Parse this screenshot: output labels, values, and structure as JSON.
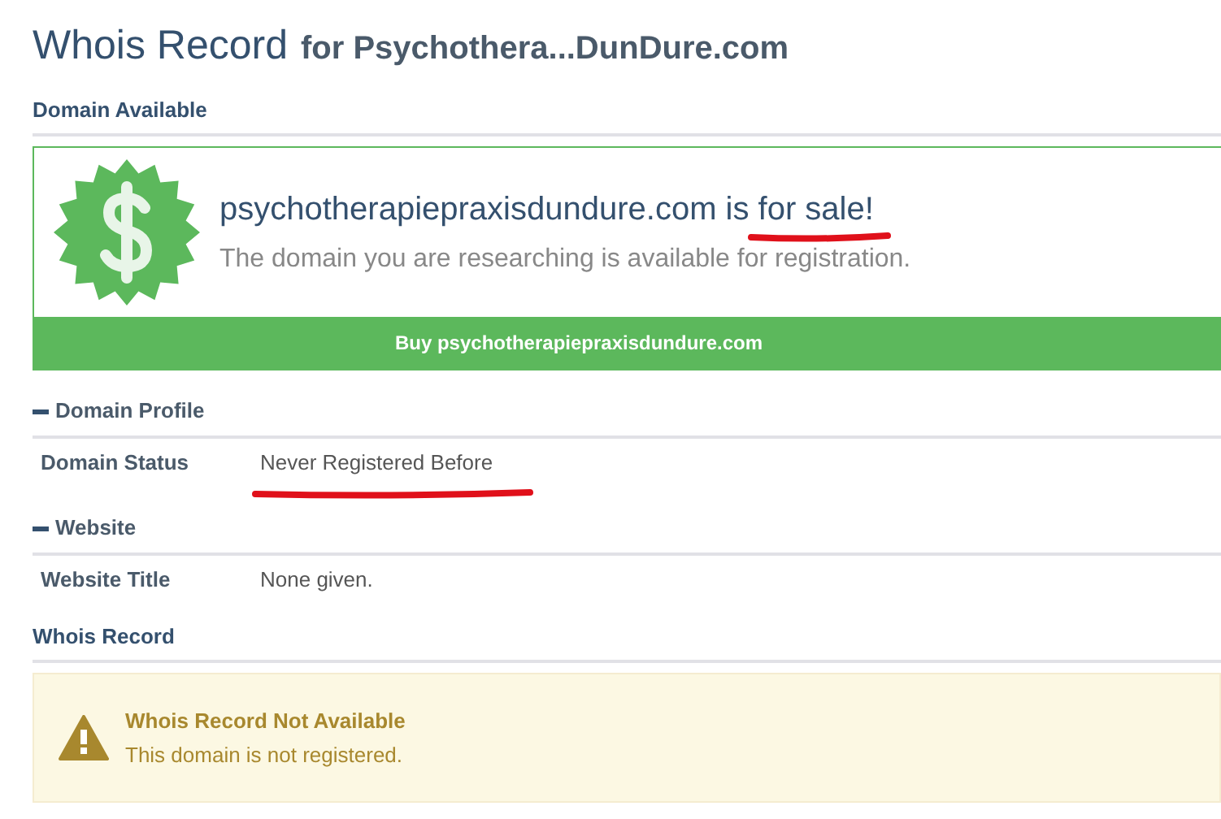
{
  "header": {
    "title": "Whois Record",
    "subtitle": "for Psychothera...DunDure.com"
  },
  "availability": {
    "heading": "Domain Available",
    "domain_line": "psychotherapiepraxisdundure.com is for sale!",
    "description": "The domain you are researching is available for registration.",
    "buy_button": "Buy psychotherapiepraxisdundure.com"
  },
  "sections": [
    {
      "title": "Domain Profile",
      "expanded": true,
      "rows": [
        {
          "label": "Domain Status",
          "value": "Never Registered Before"
        }
      ]
    },
    {
      "title": "Website",
      "expanded": true,
      "rows": [
        {
          "label": "Website Title",
          "value": "None given."
        }
      ]
    }
  ],
  "whois": {
    "heading": "Whois Record",
    "alert_title": "Whois Record Not Available",
    "alert_text": "This domain is not registered."
  }
}
